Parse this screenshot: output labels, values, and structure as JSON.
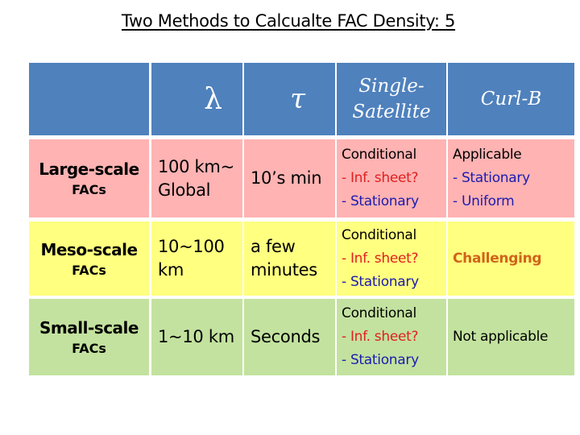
{
  "title": "Two Methods to Calcualte FAC Density: 5",
  "header": {
    "col0": "",
    "col1": "λ",
    "col2": "τ",
    "col3_line1": "Single-",
    "col3_line2": "Satellite",
    "col4": "Curl-B"
  },
  "colors": {
    "header_bg": "#4f81bd",
    "large_bg": "#ffb3b3",
    "meso_bg": "#ffff80",
    "small_bg": "#c3e29f",
    "red_text": "#e02020",
    "blue_text": "#1c1cb0",
    "orange_text": "#d0641a"
  },
  "rows": [
    {
      "label": "Large-scale",
      "sublabel": "FACs",
      "lambda_line1": "100 km~",
      "lambda_line2": "Global",
      "tau_line1": "10’s min",
      "tau_line2": "",
      "single": [
        "Conditional",
        "- Inf. sheet?",
        "- Stationary"
      ],
      "curl": [
        "Applicable",
        "- Stationary",
        "- Uniform"
      ]
    },
    {
      "label": "Meso-scale",
      "sublabel": "FACs",
      "lambda_line1": "10~100",
      "lambda_line2": "km",
      "tau_line1": "a few",
      "tau_line2": "minutes",
      "single": [
        "Conditional",
        "- Inf. sheet?",
        "- Stationary"
      ],
      "curl": [
        "Challenging"
      ]
    },
    {
      "label": "Small-scale",
      "sublabel": "FACs",
      "lambda_line1": "1~10 km",
      "lambda_line2": "",
      "tau_line1": "Seconds",
      "tau_line2": "",
      "single": [
        "Conditional",
        "- Inf. sheet?",
        "- Stationary"
      ],
      "curl": [
        "Not applicable"
      ]
    }
  ]
}
